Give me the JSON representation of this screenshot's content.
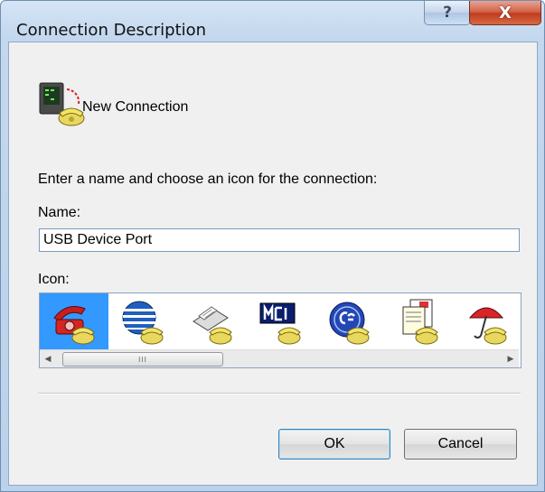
{
  "window": {
    "title": "Connection Description",
    "help_glyph": "?",
    "close_glyph": "X"
  },
  "connection": {
    "name": "New Connection",
    "icon": "phone-computer-icon"
  },
  "form": {
    "prompt": "Enter a name and choose an icon for the connection:",
    "name_label": "Name:",
    "name_value": "USB Device Port",
    "icon_label": "Icon:"
  },
  "icons": [
    {
      "name": "red-telephone-icon",
      "selected": true
    },
    {
      "name": "globe-phone-icon",
      "selected": false
    },
    {
      "name": "fax-phone-icon",
      "selected": false
    },
    {
      "name": "mci-phone-icon",
      "selected": false
    },
    {
      "name": "ge-phone-icon",
      "selected": false
    },
    {
      "name": "documents-phone-icon",
      "selected": false
    },
    {
      "name": "umbrella-phone-icon",
      "selected": false
    }
  ],
  "icon_scrollbar": {
    "thumb_grip": "III"
  },
  "buttons": {
    "ok": "OK",
    "cancel": "Cancel"
  },
  "colors": {
    "selection": "#3399ff",
    "close_button": "#c23c1f",
    "titlebar": "#c3d7ee"
  }
}
